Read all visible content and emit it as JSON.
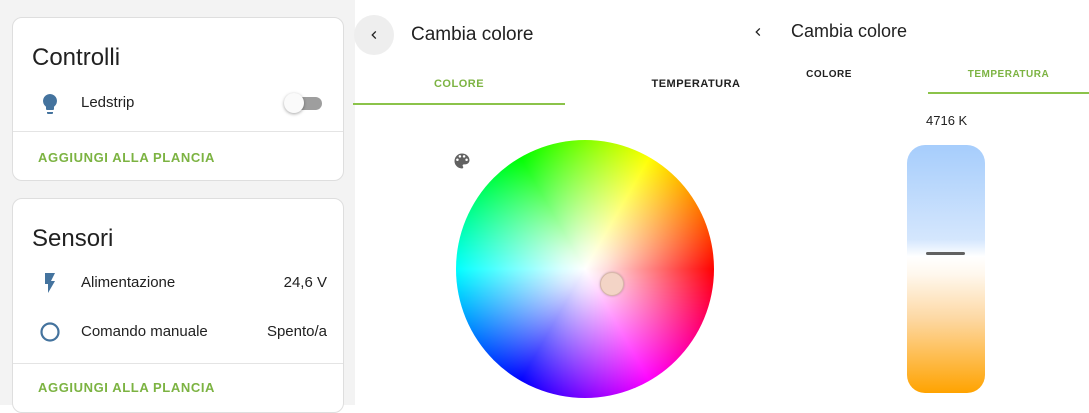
{
  "panel_left": {
    "controls_card": {
      "title": "Controlli",
      "entity": {
        "icon": "lightbulb-icon",
        "label": "Ledstrip",
        "state": "off"
      },
      "action": "AGGIUNGI ALLA PLANCIA"
    },
    "sensors_card": {
      "title": "Sensori",
      "rows": [
        {
          "icon": "flash-icon",
          "label": "Alimentazione",
          "value": "24,6 V"
        },
        {
          "icon": "circle-outline-icon",
          "label": "Comando manuale",
          "value": "Spento/a"
        }
      ],
      "action": "AGGIUNGI ALLA PLANCIA"
    }
  },
  "color_dialog": {
    "back_icon": "chevron-left-icon",
    "title": "Cambia colore",
    "tabs": [
      {
        "label": "COLORE",
        "active": true
      },
      {
        "label": "TEMPERATURA",
        "active": false
      }
    ],
    "palette_icon": "palette-icon"
  },
  "temp_dialog": {
    "back_icon": "chevron-left-icon",
    "title": "Cambia colore",
    "tabs": [
      {
        "label": "COLORE",
        "active": false
      },
      {
        "label": "TEMPERATURA",
        "active": true
      }
    ],
    "temperature_readout": "4716 K"
  },
  "colors": {
    "accent_green": "#7cb342",
    "tab_underline": "#8bc34a",
    "icon_blue": "#44739e",
    "text": "#212121"
  }
}
